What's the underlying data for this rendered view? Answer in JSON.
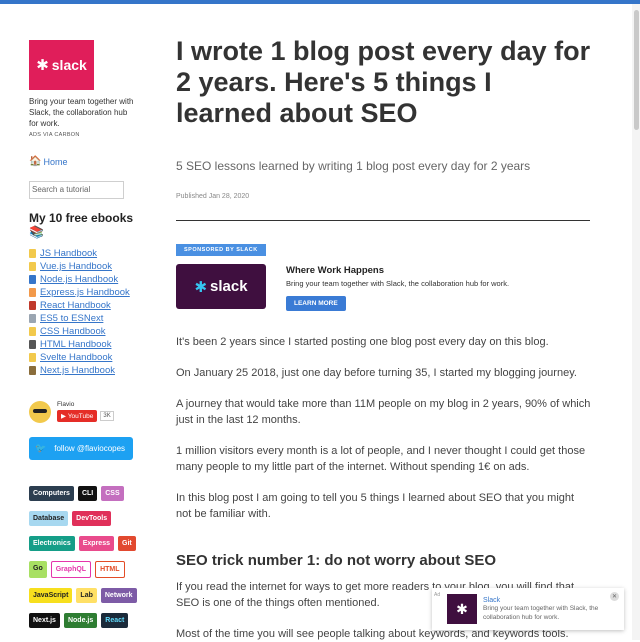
{
  "sidebar": {
    "carbon": {
      "logo_text": "slack",
      "text": "Bring your team together with Slack, the collaboration hub for work.",
      "via": "ADS VIA CARBON"
    },
    "home": "Home",
    "search_placeholder": "Search a tutorial",
    "ebooks_title": "My 10 free ebooks 📚",
    "ebooks": [
      {
        "label": "JS Handbook",
        "color": "#f2c94c"
      },
      {
        "label": "Vue.js Handbook",
        "color": "#f2c94c"
      },
      {
        "label": "Node.js Handbook",
        "color": "#3575c9"
      },
      {
        "label": "Express.js Handbook",
        "color": "#f2994a"
      },
      {
        "label": "React Handbook",
        "color": "#c0392b"
      },
      {
        "label": "ES5 to ESNext",
        "color": "#9aa5b1"
      },
      {
        "label": "CSS Handbook",
        "color": "#f2c94c"
      },
      {
        "label": "HTML Handbook",
        "color": "#555555"
      },
      {
        "label": "Svelte Handbook",
        "color": "#f2c94c"
      },
      {
        "label": "Next.js Handbook",
        "color": "#8a6d3b"
      }
    ],
    "author": {
      "name": "Flavio",
      "youtube_label": "YouTube",
      "youtube_count": "3K"
    },
    "twitter_label": "follow @flaviocopes",
    "tags": [
      [
        {
          "label": "Computers",
          "bg": "#2c3e50",
          "fg": "#ffffff"
        },
        {
          "label": "CLI",
          "bg": "#111111",
          "fg": "#ffffff"
        },
        {
          "label": "CSS",
          "bg": "#c46fbf",
          "fg": "#ffffff"
        }
      ],
      [
        {
          "label": "Database",
          "bg": "#a7d8f0",
          "fg": "#222222"
        },
        {
          "label": "DevTools",
          "bg": "#e0305a",
          "fg": "#ffffff"
        }
      ],
      [
        {
          "label": "Electronics",
          "bg": "#159e88",
          "fg": "#ffffff"
        },
        {
          "label": "Express",
          "bg": "#e94b8c",
          "fg": "#ffffff"
        },
        {
          "label": "Git",
          "bg": "#e2492f",
          "fg": "#ffffff"
        }
      ],
      [
        {
          "label": "Go",
          "bg": "#a8e063",
          "fg": "#222222"
        },
        {
          "label": "GraphQL",
          "bg": "#ffffff",
          "fg": "#e535ab",
          "border": "#e535ab"
        },
        {
          "label": "HTML",
          "bg": "#ffffff",
          "fg": "#e34c26",
          "border": "#e34c26"
        }
      ],
      [
        {
          "label": "JavaScript",
          "bg": "#f7df1e",
          "fg": "#222222"
        },
        {
          "label": "Lab",
          "bg": "#ffe066",
          "fg": "#222222"
        },
        {
          "label": "Network",
          "bg": "#7d5ba6",
          "fg": "#ffffff"
        }
      ],
      [
        {
          "label": "Next.js",
          "bg": "#111111",
          "fg": "#ffffff"
        },
        {
          "label": "Node.js",
          "bg": "#2e7d32",
          "fg": "#ffffff"
        },
        {
          "label": "React",
          "bg": "#1b2a3a",
          "fg": "#61dafb"
        }
      ]
    ]
  },
  "article": {
    "title": "I wrote 1 blog post every day for 2 years. Here's 5 things I learned about SEO",
    "subtitle": "5 SEO lessons learned by writing 1 blog post every day for 2 years",
    "published": "Published Jan 28, 2020",
    "sponsor": {
      "label": "SPONSORED BY SLACK",
      "logo_text": "slack",
      "heading": "Where Work Happens",
      "desc": "Bring your team together with Slack, the collaboration hub for work.",
      "button": "LEARN MORE"
    },
    "paragraphs": [
      "It's been 2 years since I started posting one blog post every day on this blog.",
      "On January 25 2018, just one day before turning 35, I started my blogging journey.",
      "A journey that would take more than 11M people on my blog in 2 years, 90% of which just in the last 12 months.",
      "1 million visitors every month is a lot of people, and I never thought I could get those many people to my little part of the internet. Without spending 1€ on ads.",
      "In this blog post I am going to tell you 5 things I learned about SEO that you might not be familiar with."
    ],
    "section_heading": "SEO trick number 1: do not worry about SEO",
    "section_paragraphs": [
      "If you read the internet for ways to get more readers to your blog, you will find that SEO is one of the things often mentioned.",
      "Most of the time you will see people talking about keywords, and keywords tools."
    ]
  },
  "popup": {
    "ad_label": "Ad",
    "title": "Slack",
    "desc": "Bring your team together with Slack, the collaboration hub for work."
  }
}
